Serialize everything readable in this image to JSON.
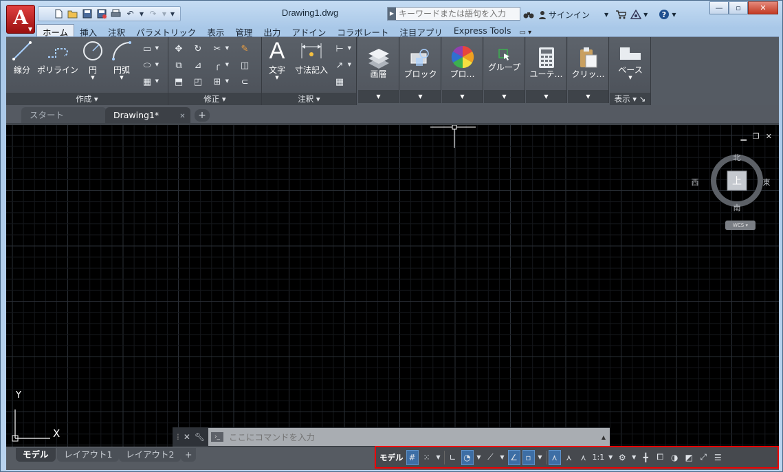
{
  "window": {
    "title": "Drawing1.dwg",
    "app_button_label": "A"
  },
  "search": {
    "placeholder": "キーワードまたは語句を入力"
  },
  "title_tools": {
    "signin_label": "サインイン"
  },
  "ribbon_tabs": [
    {
      "label": "ホーム"
    },
    {
      "label": "挿入"
    },
    {
      "label": "注釈"
    },
    {
      "label": "パラメトリック"
    },
    {
      "label": "表示"
    },
    {
      "label": "管理"
    },
    {
      "label": "出力"
    },
    {
      "label": "アドイン"
    },
    {
      "label": "コラボレート"
    },
    {
      "label": "注目アプリ"
    },
    {
      "label": "Express Tools"
    }
  ],
  "panels": {
    "draw": {
      "title": "作成",
      "line": "線分",
      "polyline": "ポリライン",
      "circle": "円",
      "arc": "円弧"
    },
    "modify": {
      "title": "修正"
    },
    "annotation": {
      "title": "注釈",
      "text": "文字",
      "dimension": "寸法記入"
    },
    "layers": {
      "label": "画層"
    },
    "block": {
      "label": "ブロック"
    },
    "properties": {
      "label": "プロ…"
    },
    "groups": {
      "label": "グループ"
    },
    "utilities": {
      "label": "ユーテ…"
    },
    "clipboard": {
      "label": "クリッ…"
    },
    "view": {
      "title": "表示",
      "base": "ベース"
    }
  },
  "file_tabs": [
    {
      "label": "スタート"
    },
    {
      "label": "Drawing1*"
    }
  ],
  "viewcube": {
    "north": "北",
    "south": "南",
    "east": "東",
    "west": "西",
    "top": "上",
    "wcs": "WCS"
  },
  "ucs": {
    "x": "X",
    "y": "Y"
  },
  "command_line": {
    "placeholder": "ここにコマンドを入力"
  },
  "layout_tabs": [
    {
      "label": "モデル"
    },
    {
      "label": "レイアウト1"
    },
    {
      "label": "レイアウト2"
    }
  ],
  "status_bar": {
    "model_label": "モデル",
    "scale_label": "1:1",
    "highlight_color": "#e00000"
  },
  "colors": {
    "canvas": "#000000",
    "ribbon": "#555b63",
    "accent": "#3d6ea5",
    "app_button": "#c8201f"
  }
}
